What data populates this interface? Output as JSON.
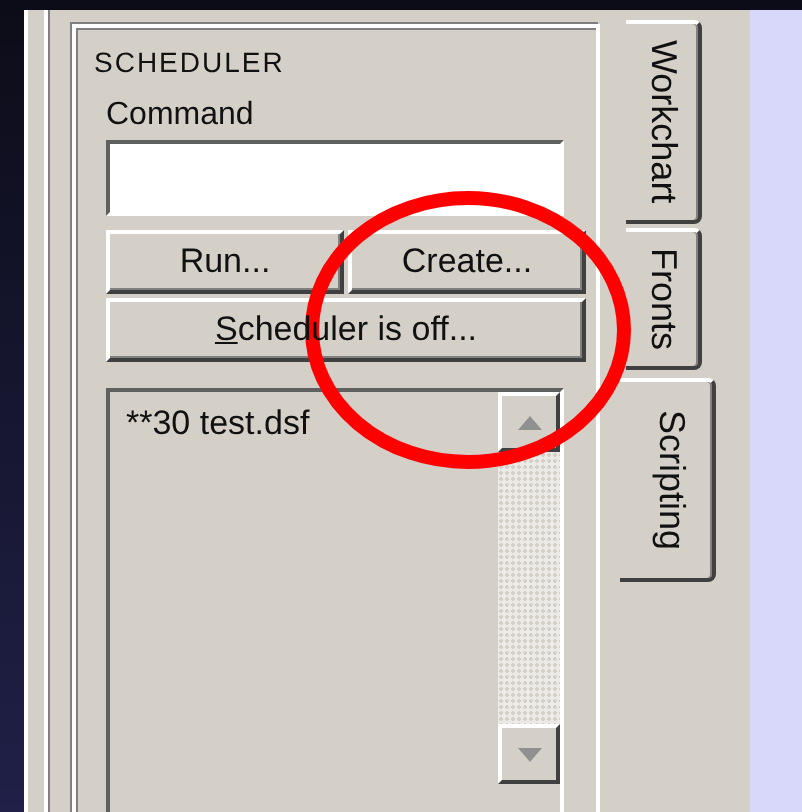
{
  "group": {
    "title": "SCHEDULER"
  },
  "command": {
    "label": "Command"
  },
  "buttons": [
    {
      "kind": "half",
      "label": "Run..."
    },
    {
      "kind": "half",
      "label": "Create..."
    },
    {
      "kind": "full",
      "label": "Scheduler is off...",
      "mnemonic_underlined": true
    }
  ],
  "list": {
    "items": [
      "**30 test.dsf"
    ]
  },
  "tabs": [
    {
      "label": "Workchart",
      "selected": false
    },
    {
      "label": "Fronts",
      "selected": false
    },
    {
      "label": "Scripting",
      "selected": true
    }
  ],
  "annotations": [
    {
      "kind": "circle",
      "color": "#ff0000"
    }
  ]
}
